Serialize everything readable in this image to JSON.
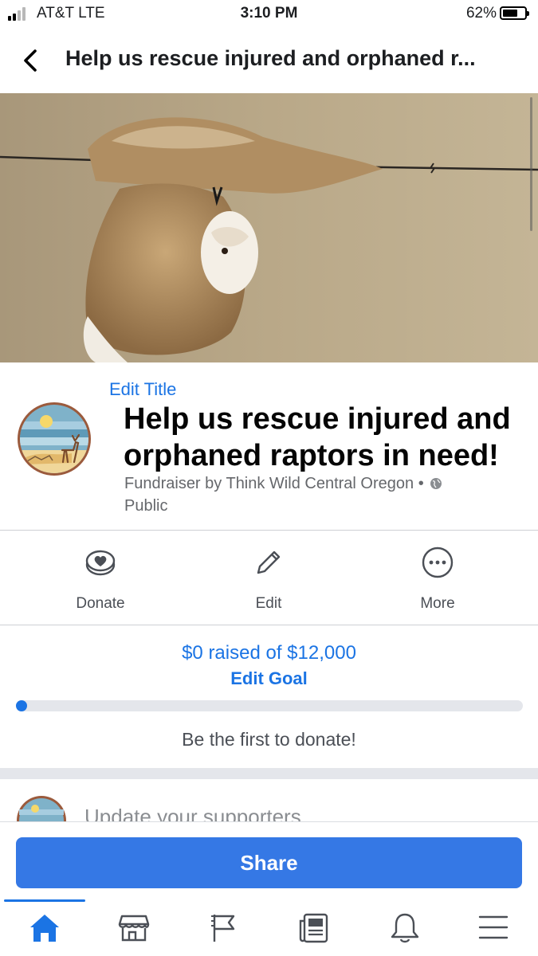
{
  "status_bar": {
    "carrier": "AT&T  LTE",
    "time": "3:10 PM",
    "battery": "62%",
    "battery_level": 0.62,
    "signal_bars": 2
  },
  "nav": {
    "title": "Help us rescue injured and orphaned r...",
    "back_icon": "chevron-left-icon"
  },
  "fundraiser": {
    "edit_title": "Edit Title",
    "title": "Help us rescue injured and orphaned raptors in need!",
    "organizer": "Fundraiser by Think Wild Central Oregon",
    "separator": "•",
    "visibility": "Public"
  },
  "actions": [
    {
      "label": "Donate",
      "icon": "donate-heart-icon"
    },
    {
      "label": "Edit",
      "icon": "pencil-icon"
    },
    {
      "label": "More",
      "icon": "more-dots-icon"
    }
  ],
  "goal": {
    "raised_text": "$0 raised of $12,000",
    "edit_goal": "Edit Goal",
    "progress": 0,
    "cta": "Be the first to donate!"
  },
  "update": {
    "placeholder": "Update your supporters"
  },
  "footer": {
    "share_label": "Share",
    "tabs": [
      {
        "name": "home-icon",
        "active": true
      },
      {
        "name": "marketplace-icon",
        "active": false
      },
      {
        "name": "pages-flag-icon",
        "active": false
      },
      {
        "name": "news-feed-icon",
        "active": false
      },
      {
        "name": "notifications-bell-icon",
        "active": false
      },
      {
        "name": "menu-icon",
        "active": false
      }
    ]
  },
  "colors": {
    "accent": "#1b74e4",
    "share_button": "#3578e5",
    "text_primary": "#050505",
    "text_secondary": "#65676b"
  }
}
